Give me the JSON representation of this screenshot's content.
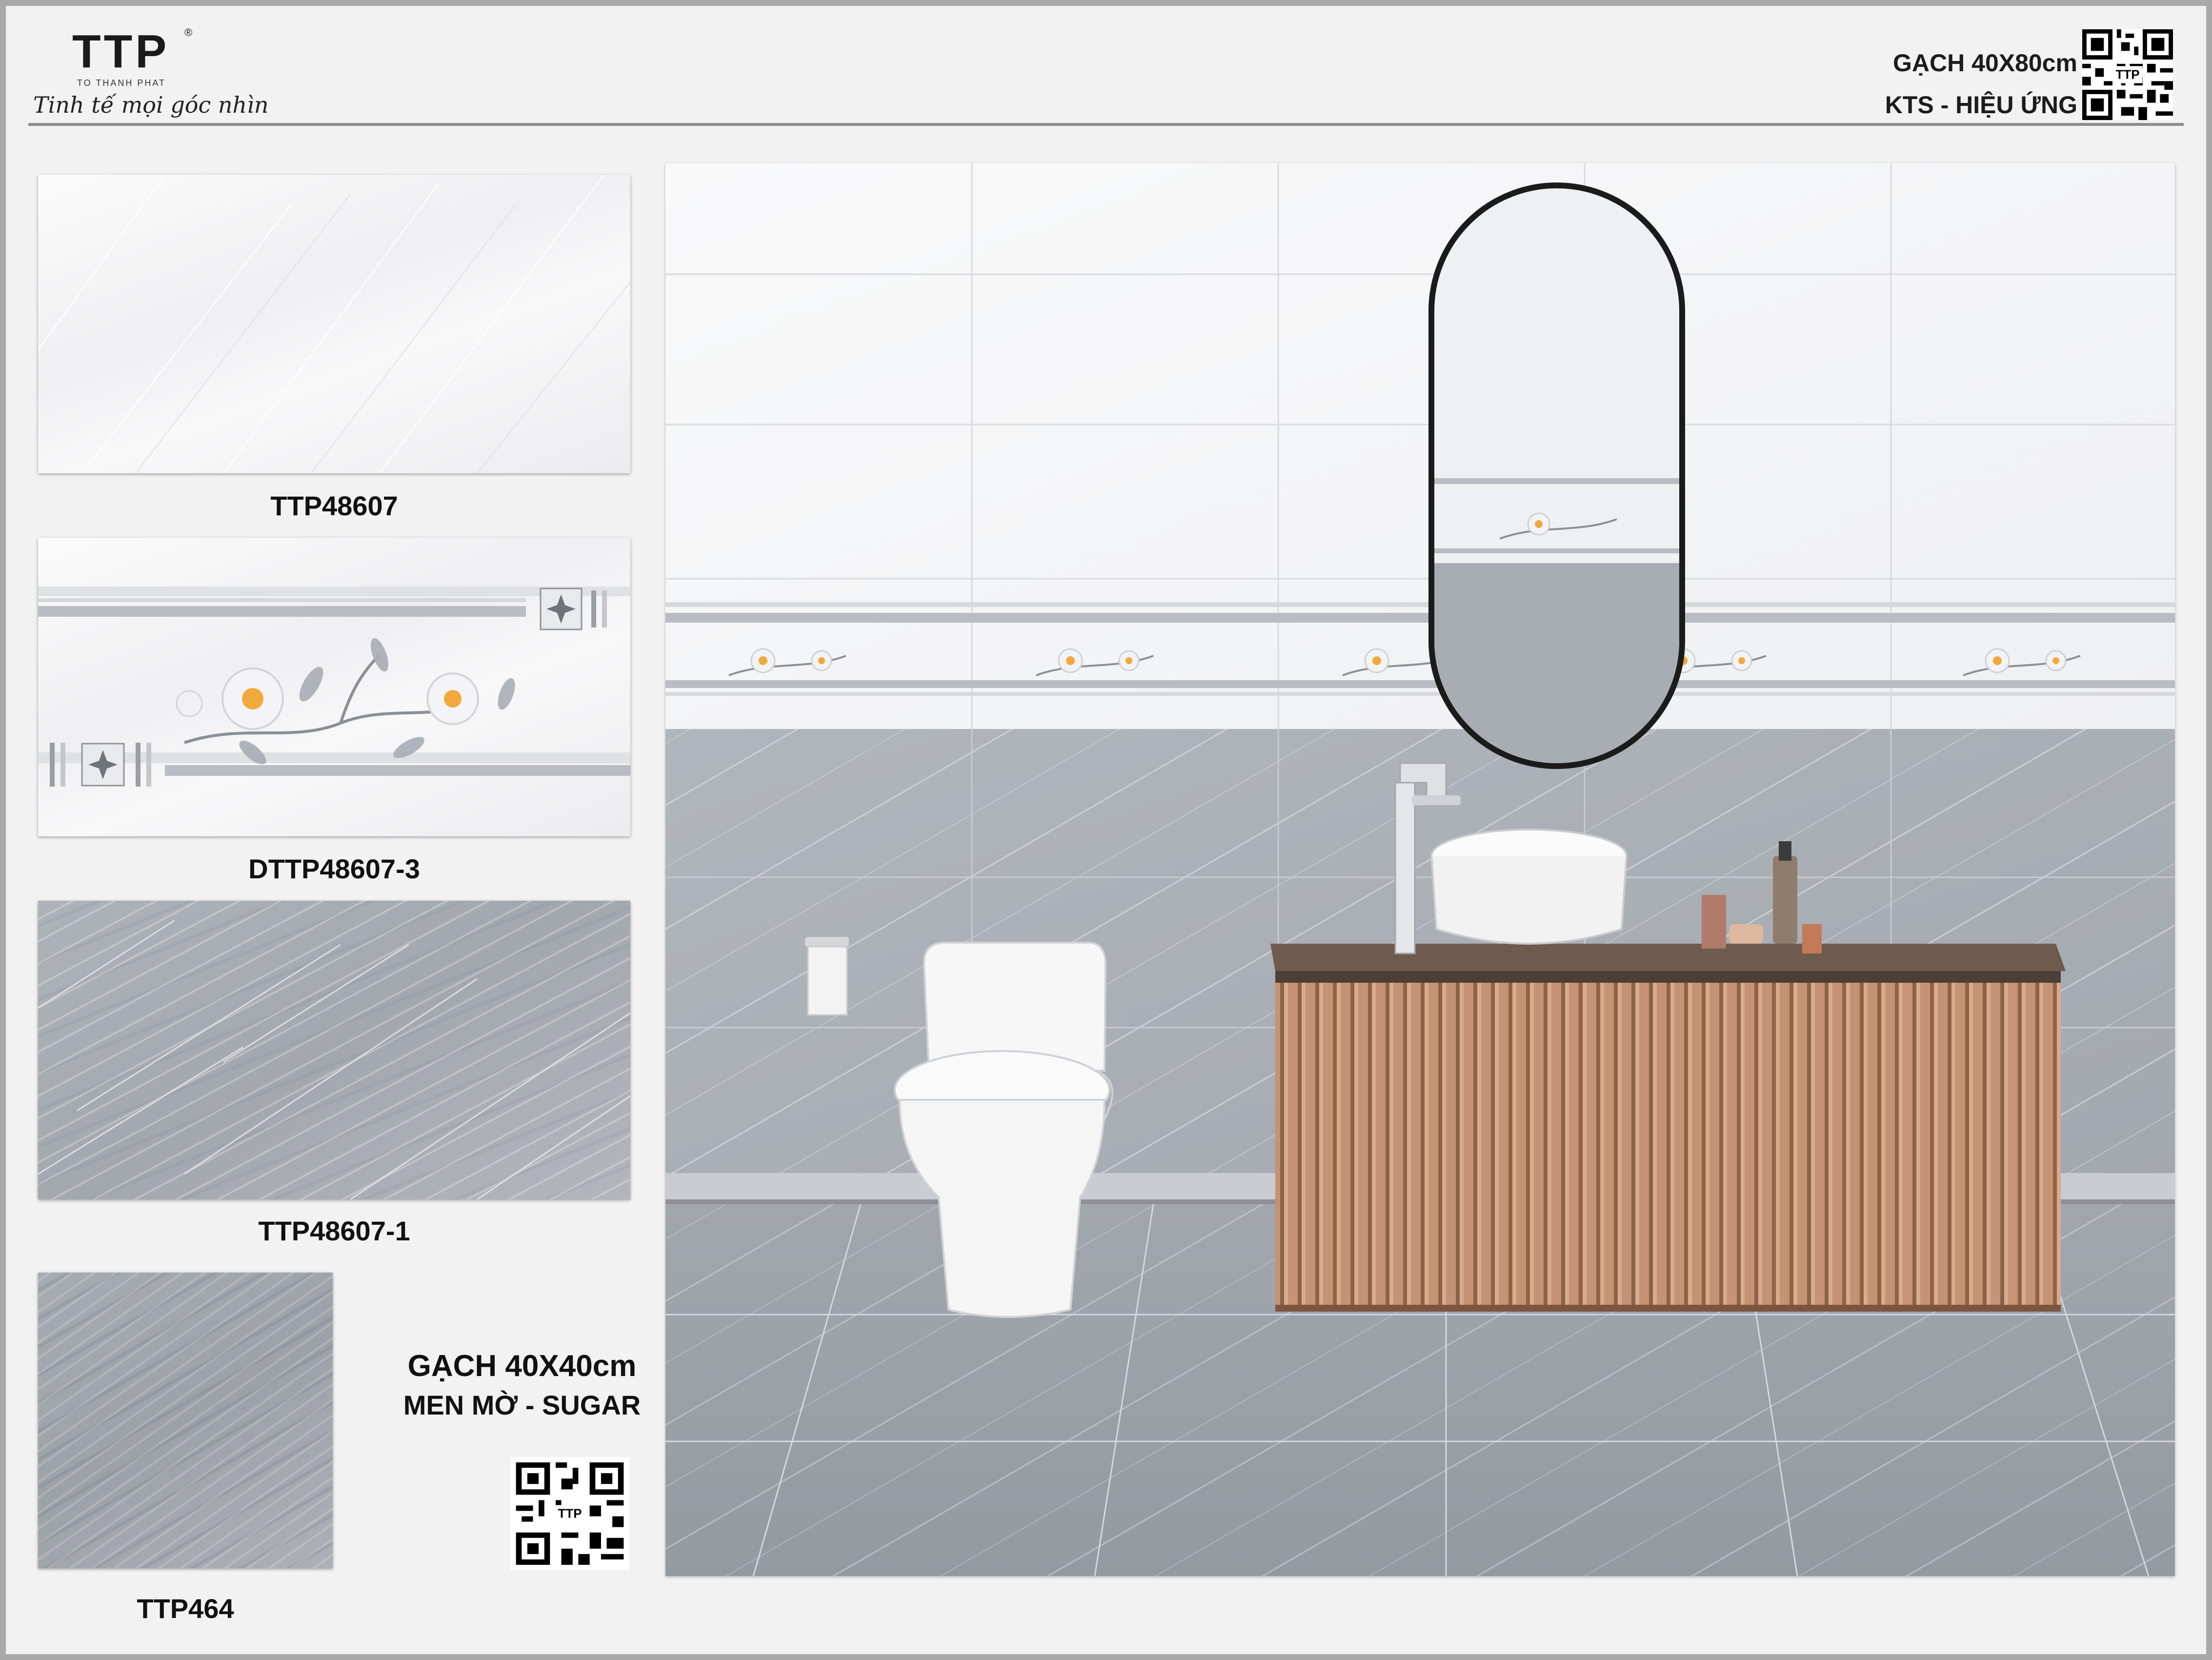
{
  "brand": {
    "logo_text": "TTP",
    "registered_mark": "®",
    "company_name": "TO THANH PHAT",
    "slogan": "Tinh tế mọi góc nhìn"
  },
  "header": {
    "product_size": "GẠCH 40X80cm",
    "product_type": "KTS - HIỆU ỨNG",
    "qr_label": "TTP"
  },
  "samples": [
    {
      "code": "TTP48607",
      "style": "white-marble"
    },
    {
      "code": "DTTP48607-3",
      "style": "floral-border"
    },
    {
      "code": "TTP48607-1",
      "style": "grey-marble"
    },
    {
      "code": "TTP464",
      "style": "grey-stone-floor"
    }
  ],
  "floor_tile": {
    "product_size": "GẠCH 40X40cm",
    "finish": "MEN MỜ - SUGAR",
    "qr_label": "TTP"
  },
  "colors": {
    "frame": "#a9a9a9",
    "background": "#f2f2f2",
    "wall_grey": "#a9adb5",
    "wall_white": "#f7f8f9",
    "vanity_wood": "#b98564"
  }
}
